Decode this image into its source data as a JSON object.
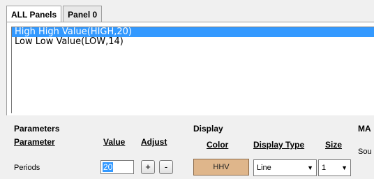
{
  "tabs": [
    "ALL Panels",
    "Panel 0"
  ],
  "list_items": [
    "High High Value(HIGH,20)",
    "Low Low Value(LOW,14)"
  ],
  "parameters": {
    "title": "Parameters",
    "col_parameter": "Parameter",
    "col_value": "Value",
    "col_adjust": "Adjust",
    "row_label": "Periods",
    "row_value": "20",
    "plus": "+",
    "minus": "-"
  },
  "display": {
    "title": "Display",
    "col_color": "Color",
    "col_type": "Display Type",
    "col_size": "Size",
    "color_label": "HHV",
    "color_hex": "#dfb68b",
    "type_value": "Line",
    "size_value": "1"
  },
  "ma": {
    "title": "MA",
    "source_label": "Sou"
  }
}
